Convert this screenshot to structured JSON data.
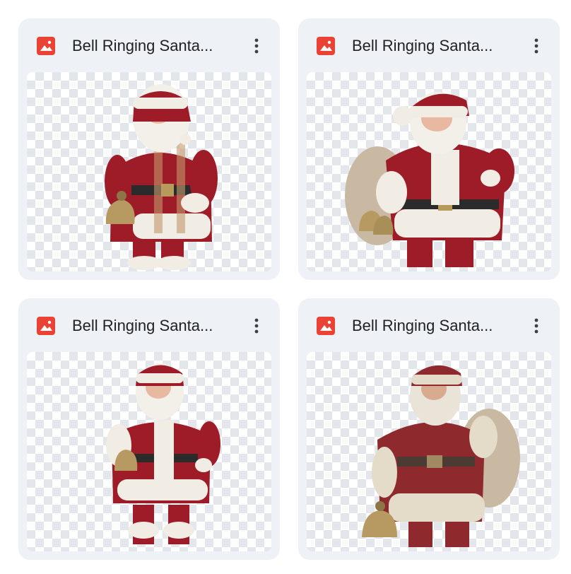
{
  "files": [
    {
      "title": "Bell Ringing Santa...",
      "icon": "image-file-icon",
      "menu_icon": "more-vert-icon"
    },
    {
      "title": "Bell Ringing Santa...",
      "icon": "image-file-icon",
      "menu_icon": "more-vert-icon"
    },
    {
      "title": "Bell Ringing Santa...",
      "icon": "image-file-icon",
      "menu_icon": "more-vert-icon"
    },
    {
      "title": "Bell Ringing Santa...",
      "icon": "image-file-icon",
      "menu_icon": "more-vert-icon"
    }
  ],
  "colors": {
    "card_bg": "#eef1f6",
    "file_icon": "#ea4335",
    "suit_red": "#9e1b28",
    "fur_white": "#f1ece4"
  }
}
